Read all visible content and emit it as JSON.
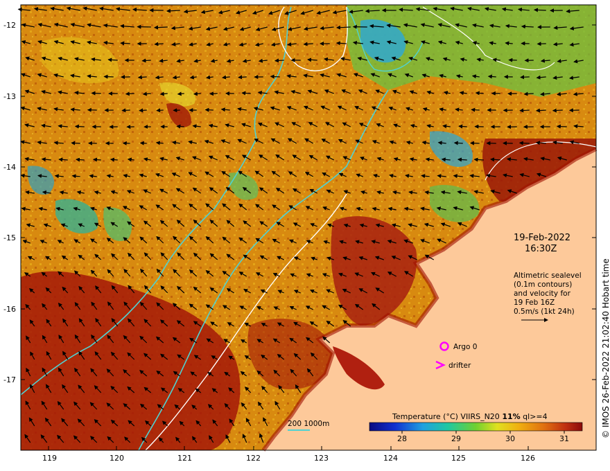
{
  "map": {
    "date": "19-Feb-2022",
    "time": "16:30Z",
    "altimetry_notes": [
      "Altimetric sealevel",
      "(0.1m contours)",
      "and velocity for",
      "19 Feb 16Z",
      "0.5m/s (1kt 24h)"
    ],
    "copyright": "© IMOS 26-Feb-2022 21:02:40 Hobart time",
    "colorbar_title": "Temperature (°C) VIIRS_N20",
    "colorbar_title_pct": "11%",
    "colorbar_title_ql": "ql>=4",
    "colorbar_ticks": [
      "28",
      "29",
      "30",
      "31"
    ],
    "isobath_label": "200  1000m",
    "legend": {
      "argo": "Argo 0",
      "drifter": "drifter"
    },
    "lat_labels": [
      "-12",
      "-13",
      "-14",
      "-15",
      "-16",
      "-17"
    ],
    "lon_labels": [
      "119",
      "120",
      "121",
      "122",
      "123",
      "124",
      "125",
      "126"
    ],
    "colors": {
      "land": "#fdc99a",
      "isobath_200": "#4fd2d2",
      "isobath_1000": "#ffffff",
      "marker": "#ff00ff",
      "sst_warm": "#c06000",
      "sst_hot": "#a01000",
      "sst_cool": "#2aa8d8"
    }
  }
}
